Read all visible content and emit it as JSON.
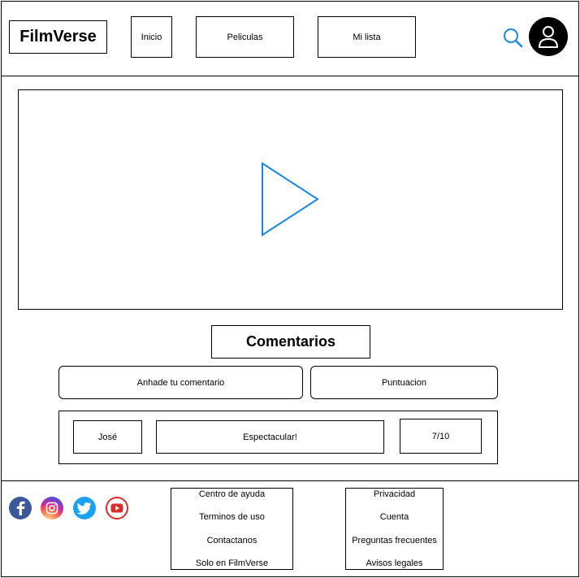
{
  "header": {
    "logo": "FilmVerse",
    "nav": [
      {
        "label": "Inicio"
      },
      {
        "label": "Peliculas"
      },
      {
        "label": "Mi lista"
      }
    ]
  },
  "icons": {
    "search": "search-icon",
    "avatar": "user-icon",
    "play": "play-icon",
    "accent": "#1a86de"
  },
  "comments": {
    "title": "Comentarios",
    "add_label": "Anhade tu comentario",
    "rating_label": "Puntuacion",
    "items": [
      {
        "user": "José",
        "text": "Espectacular!",
        "score": "7/10"
      }
    ]
  },
  "footer": {
    "social": [
      "facebook-icon",
      "instagram-icon",
      "twitter-icon",
      "youtube-icon"
    ],
    "col1": [
      "Centro de ayuda",
      "Terminos de uso",
      "Contactanos",
      "Solo en FilmVerse"
    ],
    "col2": [
      "Privacidad",
      "Cuenta",
      "Preguntas frecuentes",
      "Avisos legales"
    ]
  }
}
